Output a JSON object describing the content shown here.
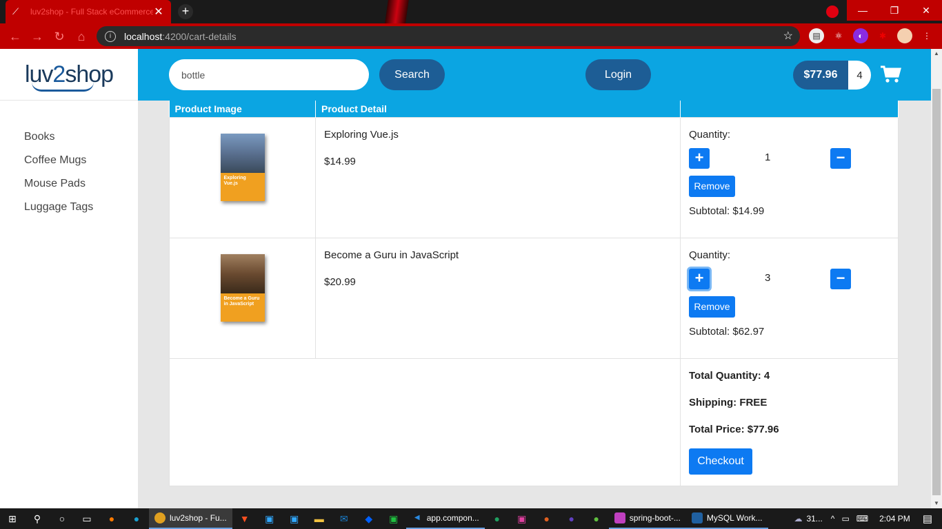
{
  "browser": {
    "tab_title": "luv2shop - Full Stack eCommerce",
    "url_host": "localhost",
    "url_path": ":4200/cart-details"
  },
  "sidebar": {
    "logo": {
      "part1": "luv",
      "part2": "2",
      "part3": "shop"
    },
    "items": [
      {
        "label": "Books"
      },
      {
        "label": "Coffee Mugs"
      },
      {
        "label": "Mouse Pads"
      },
      {
        "label": "Luggage Tags"
      }
    ]
  },
  "header": {
    "search_value": "bottle",
    "search_button": "Search",
    "login_button": "Login",
    "cart_total": "$77.96",
    "cart_count": "4"
  },
  "cart_table": {
    "columns": [
      "Product Image",
      "Product Detail",
      ""
    ],
    "quantity_label": "Quantity:",
    "remove_label": "Remove",
    "items": [
      {
        "name": "Exploring Vue.js",
        "price": "$14.99",
        "quantity": "1",
        "subtotal": "Subtotal: $14.99",
        "cover_text": "Exploring Vue.js",
        "cover_top_color": "#4a6a9a",
        "cover_bottom_color": "#f0a020"
      },
      {
        "name": "Become a Guru in JavaScript",
        "price": "$20.99",
        "quantity": "3",
        "subtotal": "Subtotal: $62.97",
        "cover_text": "Become a Guru in JavaScript",
        "cover_top_color": "#6a4a30",
        "cover_bottom_color": "#f0a020"
      }
    ],
    "totals": {
      "total_quantity": "Total Quantity: 4",
      "shipping": "Shipping: FREE",
      "total_price": "Total Price: $77.96",
      "checkout_button": "Checkout"
    }
  },
  "taskbar": {
    "apps": [
      {
        "label": "luv2shop - Fu..."
      },
      {
        "label": "app.compon..."
      },
      {
        "label": "spring-boot-..."
      },
      {
        "label": "MySQL Work..."
      }
    ],
    "weather": "31...",
    "time": "2:04 PM"
  },
  "colors": {
    "header_bg": "#0ba5e2",
    "dark_button": "#1d5d95",
    "primary_button": "#0d7af2"
  }
}
